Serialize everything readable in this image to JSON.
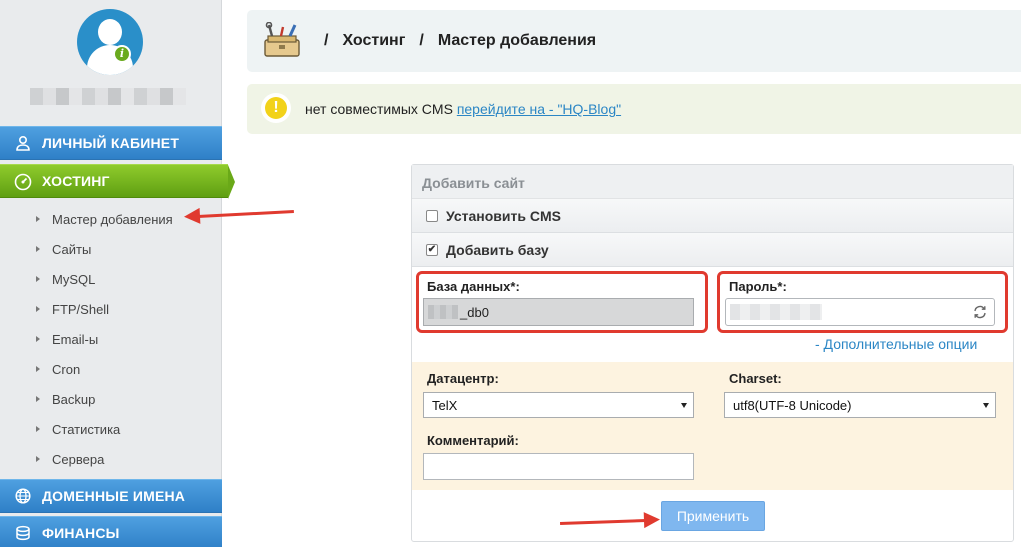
{
  "sidebar": {
    "nav": [
      {
        "label": "ЛИЧНЫЙ КАБИНЕТ",
        "icon": "user-icon"
      },
      {
        "label": "ХОСТИНГ",
        "icon": "gauge-icon"
      },
      {
        "label": "ДОМЕННЫЕ ИМЕНА",
        "icon": "globe-icon"
      },
      {
        "label": "ФИНАНСЫ",
        "icon": "coins-icon"
      }
    ],
    "hosting_items": [
      "Мастер добавления",
      "Сайты",
      "MySQL",
      "FTP/Shell",
      "Email-ы",
      "Cron",
      "Backup",
      "Статистика",
      "Сервера"
    ]
  },
  "header": {
    "crumb_sep": "/",
    "crumbs": [
      "Хостинг",
      "Мастер добавления"
    ]
  },
  "notice": {
    "text": "нет совместимых CMS ",
    "link": "перейдите на - \"HQ-Blog\""
  },
  "form": {
    "title": "Добавить сайт",
    "install_cms": "Установить CMS",
    "add_db": "Добавить базу",
    "db_label": "База данных*:",
    "db_value": "_db0",
    "password_label": "Пароль*:",
    "more_options": "- Дополнительные опции",
    "datacenter_label": "Датацентр:",
    "datacenter_value": "TelX",
    "charset_label": "Charset:",
    "charset_value": "utf8(UTF-8 Unicode)",
    "comment_label": "Комментарий:",
    "apply": "Применить"
  },
  "colors": {
    "accent_blue": "#2f80c7",
    "active_green": "#6aa918",
    "annotation_red": "#e03a2f"
  }
}
